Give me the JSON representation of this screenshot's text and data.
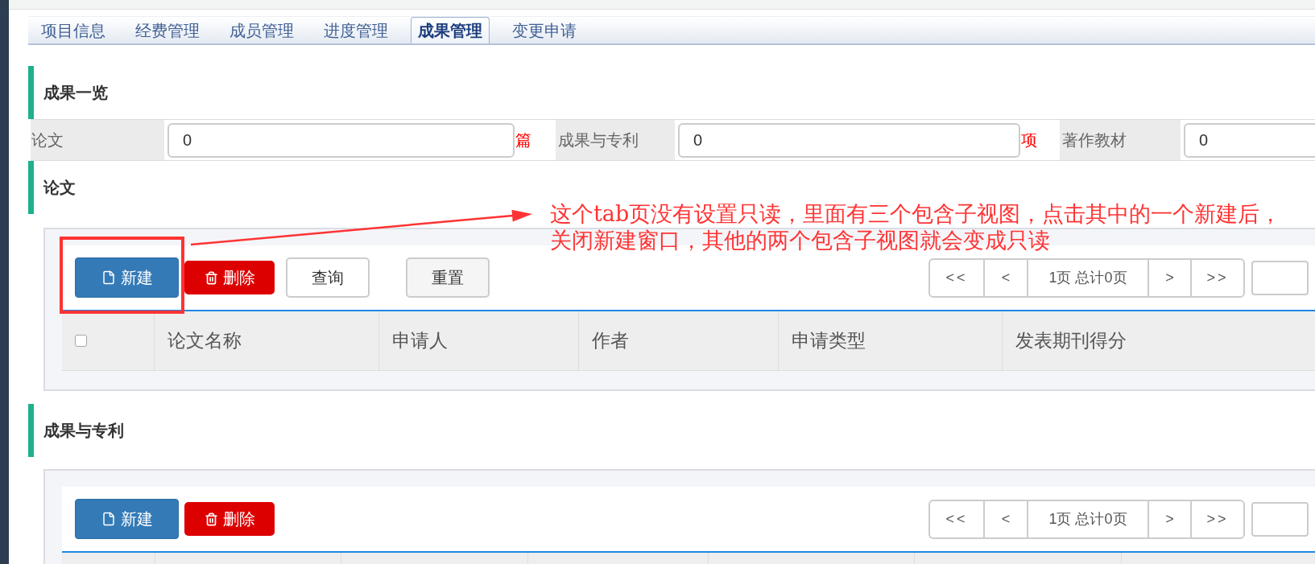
{
  "tabs": [
    {
      "label": "项目信息",
      "selected": false
    },
    {
      "label": "经费管理",
      "selected": false
    },
    {
      "label": "成员管理",
      "selected": false
    },
    {
      "label": "进度管理",
      "selected": false
    },
    {
      "label": "成果管理",
      "selected": true
    },
    {
      "label": "变更申请",
      "selected": false
    }
  ],
  "summary": {
    "title": "成果一览",
    "fields": [
      {
        "label": "论文",
        "value": "0",
        "unit": "篇"
      },
      {
        "label": "成果与专利",
        "value": "0",
        "unit": "项"
      },
      {
        "label": "著作教材",
        "value": "0"
      }
    ]
  },
  "sections": [
    {
      "title": "论文",
      "toolbar": [
        {
          "kind": "new",
          "label": "新建"
        },
        {
          "kind": "delete",
          "label": "删除"
        },
        {
          "kind": "query",
          "label": "查询"
        },
        {
          "kind": "reset",
          "label": "重置"
        }
      ],
      "pager": {
        "first": "<<",
        "prev": "<",
        "status": "1页 总计0页",
        "next": ">",
        "last": ">>"
      },
      "table": {
        "select_all": {
          "checked": false
        },
        "columns": [
          "论文名称",
          "申请人",
          "作者",
          "申请类型",
          "发表期刊得分"
        ]
      }
    },
    {
      "title": "成果与专利",
      "toolbar": [
        {
          "kind": "new",
          "label": "新建"
        },
        {
          "kind": "delete",
          "label": "删除"
        }
      ],
      "pager": {
        "first": "<<",
        "prev": "<",
        "status": "1页 总计0页",
        "next": ">",
        "last": ">>"
      }
    }
  ],
  "annotation": {
    "lines": [
      "这个tab页没有设置只读，里面有三个包含子视图，点击其中的一个新建后，",
      "关闭新建窗口，其他的两个包含子视图就会变成只读"
    ]
  }
}
